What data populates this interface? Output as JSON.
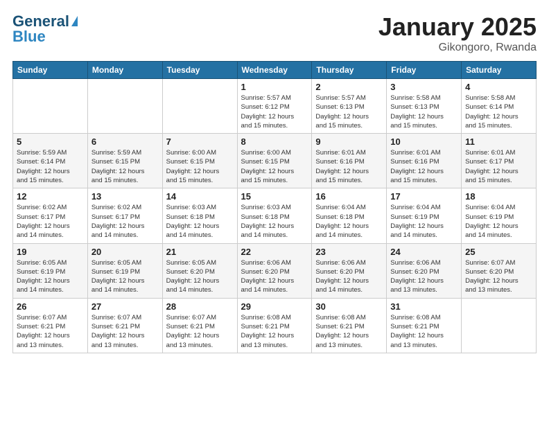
{
  "header": {
    "logo_line1": "General",
    "logo_line2": "Blue",
    "main_title": "January 2025",
    "subtitle": "Gikongoro, Rwanda"
  },
  "calendar": {
    "days_of_week": [
      "Sunday",
      "Monday",
      "Tuesday",
      "Wednesday",
      "Thursday",
      "Friday",
      "Saturday"
    ],
    "weeks": [
      [
        {
          "day": "",
          "info": ""
        },
        {
          "day": "",
          "info": ""
        },
        {
          "day": "",
          "info": ""
        },
        {
          "day": "1",
          "info": "Sunrise: 5:57 AM\nSunset: 6:12 PM\nDaylight: 12 hours\nand 15 minutes."
        },
        {
          "day": "2",
          "info": "Sunrise: 5:57 AM\nSunset: 6:13 PM\nDaylight: 12 hours\nand 15 minutes."
        },
        {
          "day": "3",
          "info": "Sunrise: 5:58 AM\nSunset: 6:13 PM\nDaylight: 12 hours\nand 15 minutes."
        },
        {
          "day": "4",
          "info": "Sunrise: 5:58 AM\nSunset: 6:14 PM\nDaylight: 12 hours\nand 15 minutes."
        }
      ],
      [
        {
          "day": "5",
          "info": "Sunrise: 5:59 AM\nSunset: 6:14 PM\nDaylight: 12 hours\nand 15 minutes."
        },
        {
          "day": "6",
          "info": "Sunrise: 5:59 AM\nSunset: 6:15 PM\nDaylight: 12 hours\nand 15 minutes."
        },
        {
          "day": "7",
          "info": "Sunrise: 6:00 AM\nSunset: 6:15 PM\nDaylight: 12 hours\nand 15 minutes."
        },
        {
          "day": "8",
          "info": "Sunrise: 6:00 AM\nSunset: 6:15 PM\nDaylight: 12 hours\nand 15 minutes."
        },
        {
          "day": "9",
          "info": "Sunrise: 6:01 AM\nSunset: 6:16 PM\nDaylight: 12 hours\nand 15 minutes."
        },
        {
          "day": "10",
          "info": "Sunrise: 6:01 AM\nSunset: 6:16 PM\nDaylight: 12 hours\nand 15 minutes."
        },
        {
          "day": "11",
          "info": "Sunrise: 6:01 AM\nSunset: 6:17 PM\nDaylight: 12 hours\nand 15 minutes."
        }
      ],
      [
        {
          "day": "12",
          "info": "Sunrise: 6:02 AM\nSunset: 6:17 PM\nDaylight: 12 hours\nand 14 minutes."
        },
        {
          "day": "13",
          "info": "Sunrise: 6:02 AM\nSunset: 6:17 PM\nDaylight: 12 hours\nand 14 minutes."
        },
        {
          "day": "14",
          "info": "Sunrise: 6:03 AM\nSunset: 6:18 PM\nDaylight: 12 hours\nand 14 minutes."
        },
        {
          "day": "15",
          "info": "Sunrise: 6:03 AM\nSunset: 6:18 PM\nDaylight: 12 hours\nand 14 minutes."
        },
        {
          "day": "16",
          "info": "Sunrise: 6:04 AM\nSunset: 6:18 PM\nDaylight: 12 hours\nand 14 minutes."
        },
        {
          "day": "17",
          "info": "Sunrise: 6:04 AM\nSunset: 6:19 PM\nDaylight: 12 hours\nand 14 minutes."
        },
        {
          "day": "18",
          "info": "Sunrise: 6:04 AM\nSunset: 6:19 PM\nDaylight: 12 hours\nand 14 minutes."
        }
      ],
      [
        {
          "day": "19",
          "info": "Sunrise: 6:05 AM\nSunset: 6:19 PM\nDaylight: 12 hours\nand 14 minutes."
        },
        {
          "day": "20",
          "info": "Sunrise: 6:05 AM\nSunset: 6:19 PM\nDaylight: 12 hours\nand 14 minutes."
        },
        {
          "day": "21",
          "info": "Sunrise: 6:05 AM\nSunset: 6:20 PM\nDaylight: 12 hours\nand 14 minutes."
        },
        {
          "day": "22",
          "info": "Sunrise: 6:06 AM\nSunset: 6:20 PM\nDaylight: 12 hours\nand 14 minutes."
        },
        {
          "day": "23",
          "info": "Sunrise: 6:06 AM\nSunset: 6:20 PM\nDaylight: 12 hours\nand 14 minutes."
        },
        {
          "day": "24",
          "info": "Sunrise: 6:06 AM\nSunset: 6:20 PM\nDaylight: 12 hours\nand 13 minutes."
        },
        {
          "day": "25",
          "info": "Sunrise: 6:07 AM\nSunset: 6:20 PM\nDaylight: 12 hours\nand 13 minutes."
        }
      ],
      [
        {
          "day": "26",
          "info": "Sunrise: 6:07 AM\nSunset: 6:21 PM\nDaylight: 12 hours\nand 13 minutes."
        },
        {
          "day": "27",
          "info": "Sunrise: 6:07 AM\nSunset: 6:21 PM\nDaylight: 12 hours\nand 13 minutes."
        },
        {
          "day": "28",
          "info": "Sunrise: 6:07 AM\nSunset: 6:21 PM\nDaylight: 12 hours\nand 13 minutes."
        },
        {
          "day": "29",
          "info": "Sunrise: 6:08 AM\nSunset: 6:21 PM\nDaylight: 12 hours\nand 13 minutes."
        },
        {
          "day": "30",
          "info": "Sunrise: 6:08 AM\nSunset: 6:21 PM\nDaylight: 12 hours\nand 13 minutes."
        },
        {
          "day": "31",
          "info": "Sunrise: 6:08 AM\nSunset: 6:21 PM\nDaylight: 12 hours\nand 13 minutes."
        },
        {
          "day": "",
          "info": ""
        }
      ]
    ]
  }
}
